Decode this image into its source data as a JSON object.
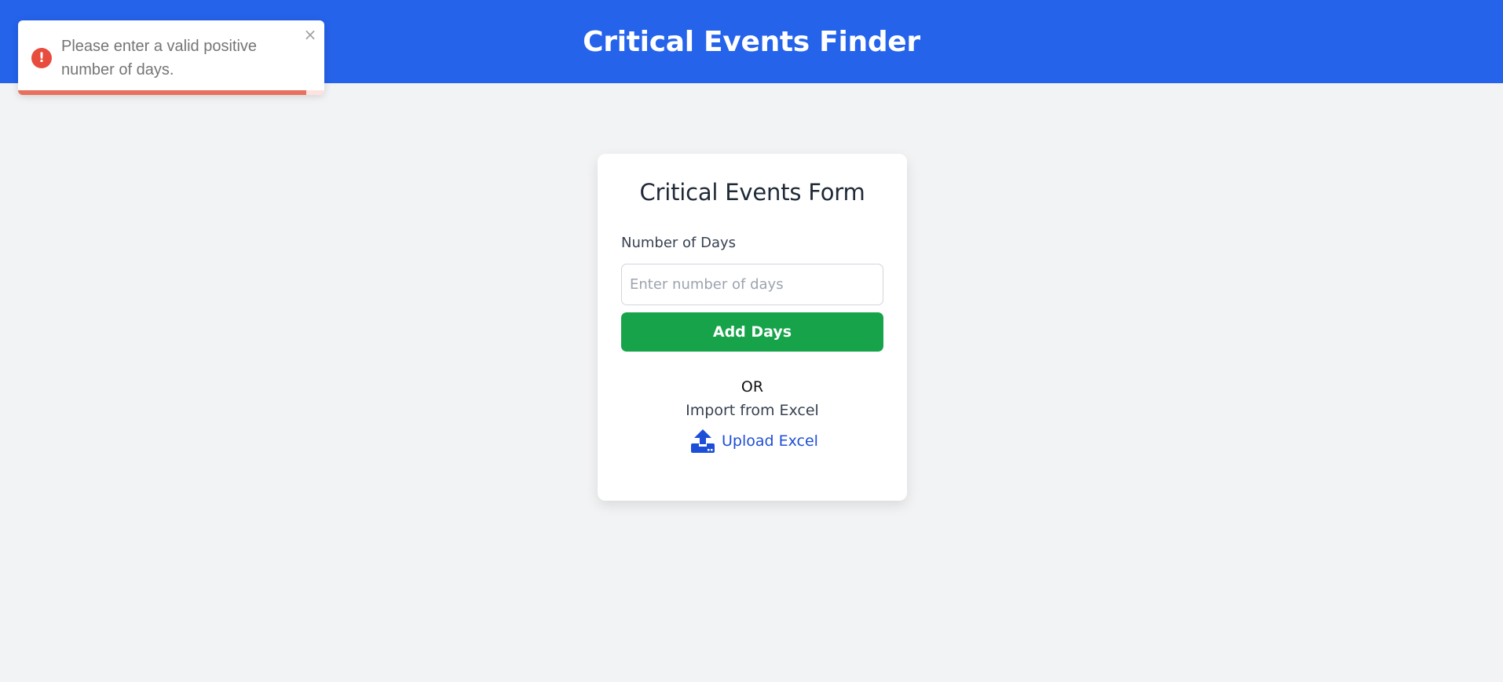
{
  "header": {
    "title": "Critical Events Finder"
  },
  "toast": {
    "icon": "error-icon",
    "message": "Please enter a valid positive number of days.",
    "close_label": "×",
    "progress_remaining": 0.94,
    "accent_color": "#e74c3c"
  },
  "form": {
    "title": "Critical Events Form",
    "days_label": "Number of Days",
    "days_value": "",
    "days_placeholder": "Enter number of days",
    "add_button_label": "Add Days",
    "or_text": "OR",
    "import_label": "Import from Excel",
    "upload_label": "Upload Excel",
    "upload_icon": "upload-icon"
  },
  "colors": {
    "header_bg": "#2563eb",
    "primary_button": "#16a34a",
    "link": "#1d4ed8",
    "page_bg": "#f2f3f5"
  }
}
